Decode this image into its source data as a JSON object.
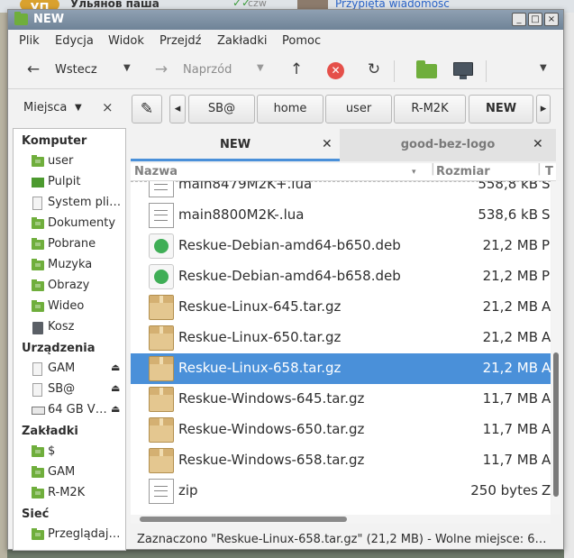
{
  "background": {
    "avatar_text": "УП",
    "user_name": "Ульянов паша",
    "day": "czw",
    "link_text": "Przypięta wiadomość"
  },
  "window": {
    "title": "NEW",
    "btn_minimize": "_",
    "btn_maximize": "□",
    "btn_close": "×"
  },
  "menu": [
    "Plik",
    "Edycja",
    "Widok",
    "Przejdź",
    "Zakładki",
    "Pomoc"
  ],
  "toolbar": {
    "back_label": "Wstecz",
    "forward_label": "Naprzód",
    "up_glyph": "↑",
    "stop_glyph": "✕",
    "reload_glyph": "↻"
  },
  "sidebar": {
    "title": "Miejsca",
    "close_glyph": "×",
    "sections": [
      {
        "heading": "Komputer",
        "items": [
          {
            "label": "user",
            "icon": "folder"
          },
          {
            "label": "Pulpit",
            "icon": "desktop"
          },
          {
            "label": "System pli…",
            "icon": "drive"
          },
          {
            "label": "Dokumenty",
            "icon": "folder"
          },
          {
            "label": "Pobrane",
            "icon": "folder"
          },
          {
            "label": "Muzyka",
            "icon": "folder"
          },
          {
            "label": "Obrazy",
            "icon": "folder"
          },
          {
            "label": "Wideo",
            "icon": "folder"
          },
          {
            "label": "Kosz",
            "icon": "trash"
          }
        ]
      },
      {
        "heading": "Urządzenia",
        "items": [
          {
            "label": "GAM",
            "icon": "drive",
            "eject": true
          },
          {
            "label": "SB@",
            "icon": "drive",
            "eject": true
          },
          {
            "label": "64 GB V…",
            "icon": "hdd",
            "eject": true
          }
        ]
      },
      {
        "heading": "Zakładki",
        "items": [
          {
            "label": "$",
            "icon": "folder"
          },
          {
            "label": "GAM",
            "icon": "folder"
          },
          {
            "label": "R-M2K",
            "icon": "folder"
          }
        ]
      },
      {
        "heading": "Sieć",
        "items": [
          {
            "label": "Przeglądaj…",
            "icon": "folder"
          }
        ]
      }
    ]
  },
  "pathbar": {
    "left_arrow": "◂",
    "right_arrow": "▸",
    "segments": [
      "SB@",
      "home",
      "user",
      "R-M2K",
      "NEW"
    ]
  },
  "tabs": [
    {
      "label": "NEW",
      "active": true
    },
    {
      "label": "good-bez-logo",
      "active": false
    }
  ],
  "columns": {
    "name": "Nazwa",
    "size": "Rozmiar",
    "type": "T"
  },
  "files": [
    {
      "name": "main8479M2K+.lua",
      "size": "558,8 kB",
      "type": "S",
      "icon": "doc"
    },
    {
      "name": "main8800M2K-.lua",
      "size": "538,6 kB",
      "type": "S",
      "icon": "doc"
    },
    {
      "name": "Reskue-Debian-amd64-b650.deb",
      "size": "21,2 MB",
      "type": "P",
      "icon": "deb"
    },
    {
      "name": "Reskue-Debian-amd64-b658.deb",
      "size": "21,2 MB",
      "type": "P",
      "icon": "deb"
    },
    {
      "name": "Reskue-Linux-645.tar.gz",
      "size": "21,2 MB",
      "type": "A",
      "icon": "pkg"
    },
    {
      "name": "Reskue-Linux-650.tar.gz",
      "size": "21,2 MB",
      "type": "A",
      "icon": "pkg"
    },
    {
      "name": "Reskue-Linux-658.tar.gz",
      "size": "21,2 MB",
      "type": "A",
      "icon": "pkg",
      "selected": true
    },
    {
      "name": "Reskue-Windows-645.tar.gz",
      "size": "11,7 MB",
      "type": "A",
      "icon": "pkg"
    },
    {
      "name": "Reskue-Windows-650.tar.gz",
      "size": "11,7 MB",
      "type": "A",
      "icon": "pkg"
    },
    {
      "name": "Reskue-Windows-658.tar.gz",
      "size": "11,7 MB",
      "type": "A",
      "icon": "pkg"
    },
    {
      "name": "zip",
      "size": "250 bytes",
      "type": "Z",
      "icon": "doc"
    }
  ],
  "status": "Zaznaczono \"Reskue-Linux-658.tar.gz\" (21,2 MB) - Wolne miejsce: 6…",
  "colors": {
    "accent": "#4a90d9",
    "folder": "#6fae3c",
    "stop": "#e5504a"
  }
}
